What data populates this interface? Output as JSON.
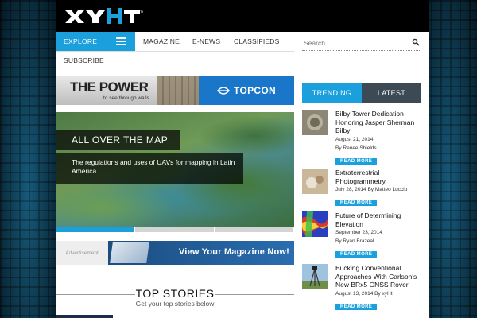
{
  "logo": {
    "text": "xyHt",
    "trademark": "TM"
  },
  "nav": {
    "explore_label": "EXPLORE",
    "items": [
      "MAGAZINE",
      "E-NEWS",
      "CLASSIFIEDS",
      "SUBSCRIBE"
    ]
  },
  "search": {
    "placeholder": "Search"
  },
  "ad_banner": {
    "headline": "THE POWER",
    "tagline": "to see through walls.",
    "brand": "TOPCON"
  },
  "hero": {
    "title": "ALL OVER THE MAP",
    "description": "The regulations and uses of UAVs for mapping in Latin America",
    "slides": 3,
    "active_slide": 1
  },
  "magazine_ad": {
    "label": "Advertisement",
    "text": "View Your Magazine Now!"
  },
  "top_stories": {
    "title": "TOP STORIES",
    "subtitle": "Get your top stories below"
  },
  "sidebar": {
    "tabs": [
      "TRENDING",
      "LATEST"
    ],
    "active_tab": "TRENDING",
    "read_more_label": "READ MORE",
    "stories": [
      {
        "title": "Bilby Tower Dedication Honoring Jasper Sherman Bilby",
        "date": "August 21, 2014",
        "author": "By Renee Shields"
      },
      {
        "title": "Extraterrestrial Photogrammetry",
        "date": "July 28, 2014 By Matteo Luccio",
        "author": ""
      },
      {
        "title": "Future of Determining Elevation",
        "date": "September 23, 2014",
        "author": "By Ryan Brazeal"
      },
      {
        "title": "Bucking Conventional Approaches With Carlson's New BRx5 GNSS Rover",
        "date": "August 13, 2014 By xyHt",
        "author": ""
      }
    ]
  },
  "colors": {
    "accent": "#1ba0dd",
    "header": "#000000",
    "tab_inactive": "#3c4a56"
  }
}
